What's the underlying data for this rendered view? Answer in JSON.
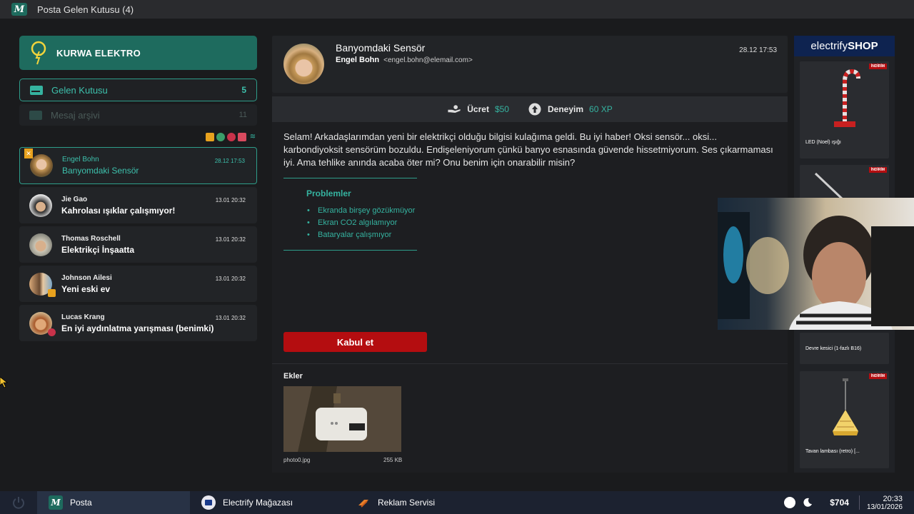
{
  "window": {
    "title": "Posta Gelen Kutusu (4)",
    "logo_letter": "M"
  },
  "company": {
    "name": "KURWA ELEKTRO"
  },
  "folders": [
    {
      "label": "Gelen Kutusu",
      "count": "5"
    },
    {
      "label": "Mesaj arşivi",
      "count": "11"
    }
  ],
  "mails": [
    {
      "sender": "Engel Bohn",
      "subject": "Banyomdaki Sensör",
      "time": "28.12 17:53"
    },
    {
      "sender": "Jie Gao",
      "subject": "Kahrolası ışıklar çalışmıyor!",
      "time": "13.01 20:32"
    },
    {
      "sender": "Thomas Roschell",
      "subject": "Elektrikçi İnşaatta",
      "time": "13.01 20:32"
    },
    {
      "sender": "Johnson Ailesi",
      "subject": "Yeni eski ev",
      "time": "13.01 20:32"
    },
    {
      "sender": "Lucas Krang",
      "subject": "En iyi aydınlatma yarışması (benimki)",
      "time": "13.01 20:32"
    }
  ],
  "message": {
    "subject": "Banyomdaki Sensör",
    "from_name": "Engel Bohn",
    "from_email": "<engel.bohn@elemail.com>",
    "time": "28.12 17:53",
    "fee_label": "Ücret",
    "fee_value": "$50",
    "xp_label": "Deneyim",
    "xp_value": "60 XP",
    "body": "Selam! Arkadaşlarımdan yeni bir elektrikçi olduğu bilgisi kulağıma geldi. Bu iyi haber!  Oksi sensör... oksi... karbondiyoksit sensörüm bozuldu. Endişeleniyorum çünkü banyo esnasında güvende hissetmiyorum. Ses çıkarmaması iyi. Ama tehlike anında acaba öter mi? Onu benim için onarabilir misin?",
    "problems_title": "Problemler",
    "problems": [
      "Ekranda birşey gözükmüyor",
      "Ekran CO2 algılamıyor",
      "Bataryalar çalışmıyor"
    ],
    "accept_label": "Kabul et",
    "attachments_label": "Ekler",
    "attachment_name": "photo0.jpg",
    "attachment_size": "255 KB"
  },
  "shop": {
    "brand_light": "electrify",
    "brand_bold": "SHOP",
    "sale_badge": "İNDİRİM",
    "products": [
      {
        "name": "LED (Noel) ışığı"
      },
      {
        "name": "Devre kesici (1-fazlı B16)"
      },
      {
        "name": "Tavan lambası (retro) [..."
      }
    ]
  },
  "taskbar": {
    "items": [
      "Posta",
      "Electrify Mağazası",
      "Reklam Servisi"
    ],
    "money": "$704",
    "time": "20:33",
    "date": "13/01/2026"
  },
  "colors": {
    "accent": "#1e6b5e",
    "teal_text": "#35b3a0",
    "accept": "#b40d10",
    "shop_header": "#0e2350"
  }
}
